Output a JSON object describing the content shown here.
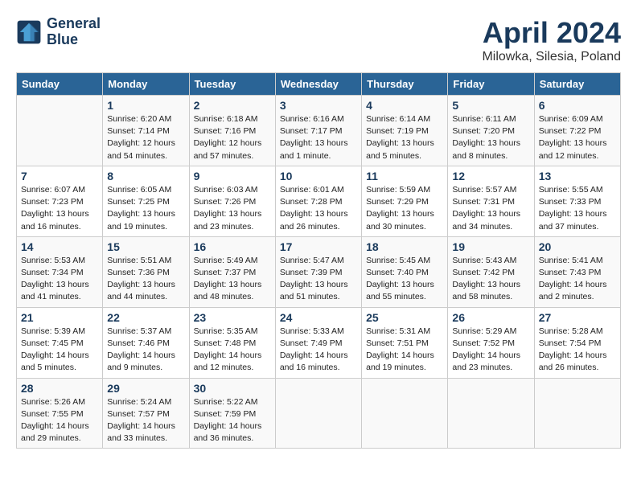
{
  "header": {
    "logo_line1": "General",
    "logo_line2": "Blue",
    "month": "April 2024",
    "location": "Milowka, Silesia, Poland"
  },
  "days_of_week": [
    "Sunday",
    "Monday",
    "Tuesday",
    "Wednesday",
    "Thursday",
    "Friday",
    "Saturday"
  ],
  "weeks": [
    [
      {
        "day": "",
        "content": ""
      },
      {
        "day": "1",
        "content": "Sunrise: 6:20 AM\nSunset: 7:14 PM\nDaylight: 12 hours\nand 54 minutes."
      },
      {
        "day": "2",
        "content": "Sunrise: 6:18 AM\nSunset: 7:16 PM\nDaylight: 12 hours\nand 57 minutes."
      },
      {
        "day": "3",
        "content": "Sunrise: 6:16 AM\nSunset: 7:17 PM\nDaylight: 13 hours\nand 1 minute."
      },
      {
        "day": "4",
        "content": "Sunrise: 6:14 AM\nSunset: 7:19 PM\nDaylight: 13 hours\nand 5 minutes."
      },
      {
        "day": "5",
        "content": "Sunrise: 6:11 AM\nSunset: 7:20 PM\nDaylight: 13 hours\nand 8 minutes."
      },
      {
        "day": "6",
        "content": "Sunrise: 6:09 AM\nSunset: 7:22 PM\nDaylight: 13 hours\nand 12 minutes."
      }
    ],
    [
      {
        "day": "7",
        "content": "Sunrise: 6:07 AM\nSunset: 7:23 PM\nDaylight: 13 hours\nand 16 minutes."
      },
      {
        "day": "8",
        "content": "Sunrise: 6:05 AM\nSunset: 7:25 PM\nDaylight: 13 hours\nand 19 minutes."
      },
      {
        "day": "9",
        "content": "Sunrise: 6:03 AM\nSunset: 7:26 PM\nDaylight: 13 hours\nand 23 minutes."
      },
      {
        "day": "10",
        "content": "Sunrise: 6:01 AM\nSunset: 7:28 PM\nDaylight: 13 hours\nand 26 minutes."
      },
      {
        "day": "11",
        "content": "Sunrise: 5:59 AM\nSunset: 7:29 PM\nDaylight: 13 hours\nand 30 minutes."
      },
      {
        "day": "12",
        "content": "Sunrise: 5:57 AM\nSunset: 7:31 PM\nDaylight: 13 hours\nand 34 minutes."
      },
      {
        "day": "13",
        "content": "Sunrise: 5:55 AM\nSunset: 7:33 PM\nDaylight: 13 hours\nand 37 minutes."
      }
    ],
    [
      {
        "day": "14",
        "content": "Sunrise: 5:53 AM\nSunset: 7:34 PM\nDaylight: 13 hours\nand 41 minutes."
      },
      {
        "day": "15",
        "content": "Sunrise: 5:51 AM\nSunset: 7:36 PM\nDaylight: 13 hours\nand 44 minutes."
      },
      {
        "day": "16",
        "content": "Sunrise: 5:49 AM\nSunset: 7:37 PM\nDaylight: 13 hours\nand 48 minutes."
      },
      {
        "day": "17",
        "content": "Sunrise: 5:47 AM\nSunset: 7:39 PM\nDaylight: 13 hours\nand 51 minutes."
      },
      {
        "day": "18",
        "content": "Sunrise: 5:45 AM\nSunset: 7:40 PM\nDaylight: 13 hours\nand 55 minutes."
      },
      {
        "day": "19",
        "content": "Sunrise: 5:43 AM\nSunset: 7:42 PM\nDaylight: 13 hours\nand 58 minutes."
      },
      {
        "day": "20",
        "content": "Sunrise: 5:41 AM\nSunset: 7:43 PM\nDaylight: 14 hours\nand 2 minutes."
      }
    ],
    [
      {
        "day": "21",
        "content": "Sunrise: 5:39 AM\nSunset: 7:45 PM\nDaylight: 14 hours\nand 5 minutes."
      },
      {
        "day": "22",
        "content": "Sunrise: 5:37 AM\nSunset: 7:46 PM\nDaylight: 14 hours\nand 9 minutes."
      },
      {
        "day": "23",
        "content": "Sunrise: 5:35 AM\nSunset: 7:48 PM\nDaylight: 14 hours\nand 12 minutes."
      },
      {
        "day": "24",
        "content": "Sunrise: 5:33 AM\nSunset: 7:49 PM\nDaylight: 14 hours\nand 16 minutes."
      },
      {
        "day": "25",
        "content": "Sunrise: 5:31 AM\nSunset: 7:51 PM\nDaylight: 14 hours\nand 19 minutes."
      },
      {
        "day": "26",
        "content": "Sunrise: 5:29 AM\nSunset: 7:52 PM\nDaylight: 14 hours\nand 23 minutes."
      },
      {
        "day": "27",
        "content": "Sunrise: 5:28 AM\nSunset: 7:54 PM\nDaylight: 14 hours\nand 26 minutes."
      }
    ],
    [
      {
        "day": "28",
        "content": "Sunrise: 5:26 AM\nSunset: 7:55 PM\nDaylight: 14 hours\nand 29 minutes."
      },
      {
        "day": "29",
        "content": "Sunrise: 5:24 AM\nSunset: 7:57 PM\nDaylight: 14 hours\nand 33 minutes."
      },
      {
        "day": "30",
        "content": "Sunrise: 5:22 AM\nSunset: 7:59 PM\nDaylight: 14 hours\nand 36 minutes."
      },
      {
        "day": "",
        "content": ""
      },
      {
        "day": "",
        "content": ""
      },
      {
        "day": "",
        "content": ""
      },
      {
        "day": "",
        "content": ""
      }
    ]
  ]
}
